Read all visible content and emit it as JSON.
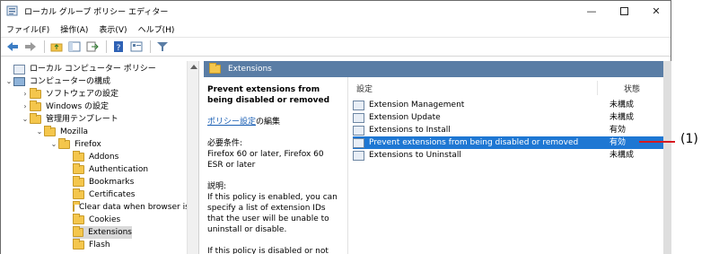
{
  "window": {
    "title": "ローカル グループ ポリシー エディター",
    "min_symbol": "—",
    "close_symbol": "✕"
  },
  "menu": [
    {
      "label": "ファイル(F)"
    },
    {
      "label": "操作(A)"
    },
    {
      "label": "表示(V)"
    },
    {
      "label": "ヘルプ(H)"
    }
  ],
  "tree": {
    "items": [
      {
        "label": "ローカル コンピューター ポリシー",
        "icon": "policy-icon"
      },
      {
        "label": "コンピューターの構成",
        "icon": "computer-icon",
        "expander": "⌄"
      },
      {
        "label": "ソフトウェアの設定",
        "icon": "folder-icon",
        "expander": "›"
      },
      {
        "label": "Windows の設定",
        "icon": "folder-icon",
        "expander": "›"
      },
      {
        "label": "管理用テンプレート",
        "icon": "folder-icon",
        "expander": "⌄"
      },
      {
        "label": "Mozilla",
        "icon": "folder-icon",
        "expander": "⌄"
      },
      {
        "label": "Firefox",
        "icon": "folder-icon",
        "expander": "⌄"
      },
      {
        "label": "Addons",
        "icon": "folder-icon"
      },
      {
        "label": "Authentication",
        "icon": "folder-icon"
      },
      {
        "label": "Bookmarks",
        "icon": "folder-icon"
      },
      {
        "label": "Certificates",
        "icon": "folder-icon"
      },
      {
        "label": "Clear data when browser is",
        "icon": "folder-icon"
      },
      {
        "label": "Cookies",
        "icon": "folder-icon"
      },
      {
        "label": "Extensions",
        "icon": "folder-icon",
        "selected": true
      },
      {
        "label": "Flash",
        "icon": "folder-icon"
      }
    ]
  },
  "content": {
    "header": "Extensions",
    "description": {
      "title": "Prevent extensions from being disabled or removed",
      "edit_link": "ポリシー設定",
      "edit_suffix": "の編集",
      "requirements_label": "必要条件:",
      "requirements_text": "Firefox 60 or later, Firefox 60 ESR or later",
      "explanation_label": "説明:",
      "explanation_text": "If this policy is enabled, you can specify a list of extension IDs that the user will be unable to uninstall or disable.",
      "explanation_more": "If this policy is disabled or not"
    },
    "columns": {
      "setting": "設定",
      "state": "状態"
    },
    "policies": [
      {
        "name": "Extension Management",
        "state": "未構成"
      },
      {
        "name": "Extension Update",
        "state": "未構成"
      },
      {
        "name": "Extensions to Install",
        "state": "有効"
      },
      {
        "name": "Prevent extensions from being disabled or removed",
        "state": "有効",
        "selected": true
      },
      {
        "name": "Extensions to Uninstall",
        "state": "未構成"
      }
    ]
  },
  "annotation": {
    "label": "(1)",
    "color": "#d71920"
  },
  "colors": {
    "header_bar": "#5a7da5",
    "selection": "#1e77d3",
    "link": "#1a5fb4"
  }
}
